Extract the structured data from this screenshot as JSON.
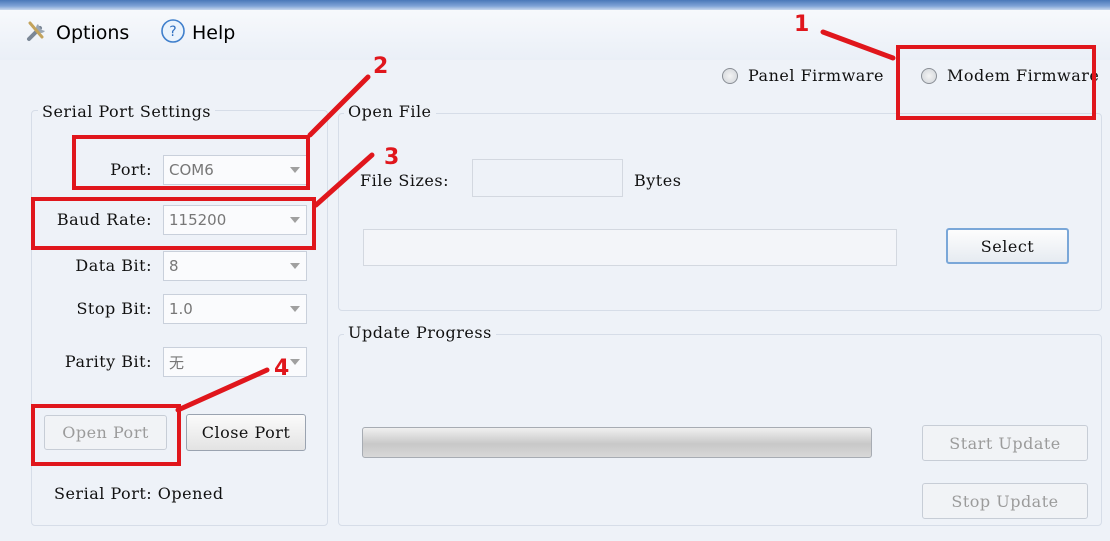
{
  "menu": {
    "options_label": "Options",
    "help_label": "Help",
    "options_icon": "tools-icon",
    "help_icon": "help-circle-icon"
  },
  "firmware": {
    "panel_label": "Panel Firmware",
    "modem_label": "Modem Firmware"
  },
  "serial_settings": {
    "title": "Serial Port Settings",
    "port": {
      "label": "Port:",
      "value": "COM6"
    },
    "baud_rate": {
      "label": "Baud Rate:",
      "value": "115200"
    },
    "data_bit": {
      "label": "Data Bit:",
      "value": "8"
    },
    "stop_bit": {
      "label": "Stop Bit:",
      "value": "1.0"
    },
    "parity_bit": {
      "label": "Parity Bit:",
      "value": "无"
    },
    "open_port_label": "Open Port",
    "close_port_label": "Close Port",
    "status_text": "Serial Port: Opened"
  },
  "open_file": {
    "title": "Open File",
    "file_sizes_label": "File Sizes:",
    "bytes_label": "Bytes",
    "file_size_value": "",
    "file_path_value": "",
    "select_label": "Select"
  },
  "update_progress": {
    "title": "Update Progress",
    "progress_value": 0,
    "start_label": "Start Update",
    "stop_label": "Stop Update"
  },
  "annotations": {
    "callout_1": "1",
    "callout_2": "2",
    "callout_3": "3",
    "callout_4": "4",
    "color": "#e0161c"
  }
}
